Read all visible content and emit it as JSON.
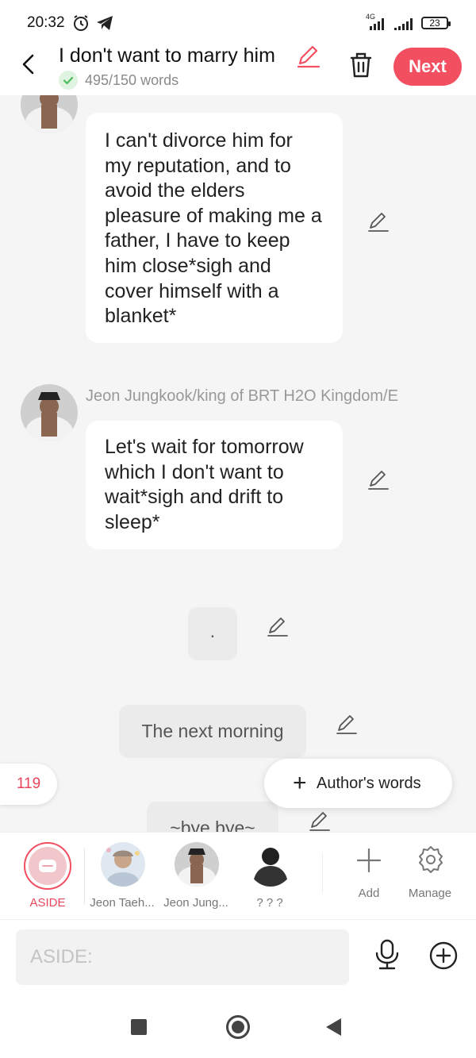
{
  "status_bar": {
    "time": "20:32",
    "battery": "23",
    "network": "4G"
  },
  "header": {
    "title": "I don't want to marry him",
    "word_count": "495/150 words",
    "next_label": "Next"
  },
  "chat": {
    "messages": [
      {
        "text": "I can't divorce him for my reputation, and to avoid the elders pleasure of making me a father, I have to keep him close*sigh and cover himself with a blanket*"
      },
      {
        "name": "Jeon Jungkook/king of BRT H2O Kingdom/E",
        "text": "Let's wait for tomorrow which I don't want to wait*sigh and drift to sleep*"
      }
    ],
    "narrations": [
      ".",
      "The next morning",
      "~bye bye~"
    ],
    "message_count": "119",
    "author_words_label": "Author's words"
  },
  "characters": {
    "aside_label": "ASIDE",
    "list": [
      {
        "label": "Jeon Taeh..."
      },
      {
        "label": "Jeon Jung..."
      },
      {
        "label": "? ? ?"
      }
    ],
    "add_label": "Add",
    "manage_label": "Manage"
  },
  "input": {
    "placeholder": "ASIDE:"
  },
  "colors": {
    "accent": "#f24f61",
    "background": "#f5f5f5"
  },
  "icons": [
    "back-icon",
    "pencil-icon",
    "check-icon",
    "trash-icon",
    "plus-icon",
    "gear-icon",
    "microphone-icon",
    "add-circle-icon",
    "alarm-icon",
    "telegram-icon",
    "signal-icon",
    "battery-icon"
  ]
}
